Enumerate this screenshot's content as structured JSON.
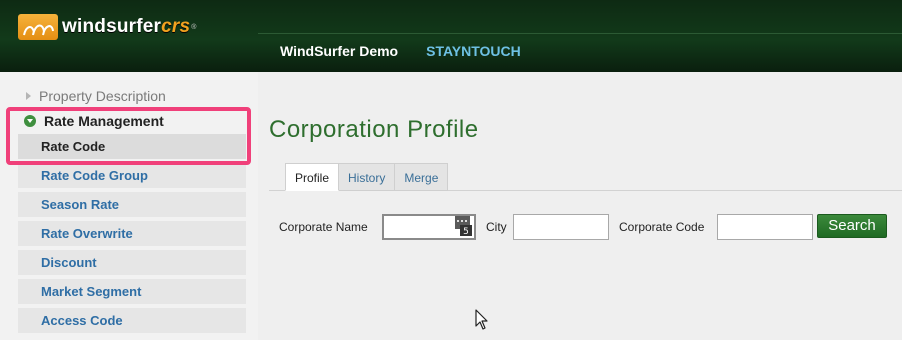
{
  "brand": {
    "logo_text_main": "windsurfer",
    "logo_text_accent": "crs",
    "trademark": "®"
  },
  "topnav": {
    "items": [
      "WindSurfer Demo",
      "STAYNTOUCH"
    ]
  },
  "sidebar": {
    "sections": [
      {
        "label": "Property Description",
        "expanded": false
      },
      {
        "label": "Rate Management",
        "expanded": true
      }
    ],
    "items": [
      {
        "label": "Rate Code",
        "active": true
      },
      {
        "label": "Rate Code Group"
      },
      {
        "label": "Season Rate"
      },
      {
        "label": "Rate Overwrite"
      },
      {
        "label": "Discount"
      },
      {
        "label": "Market Segment"
      },
      {
        "label": "Access Code"
      }
    ]
  },
  "main": {
    "title": "Corporation Profile",
    "tabs": [
      {
        "label": "Profile",
        "active": true
      },
      {
        "label": "History"
      },
      {
        "label": "Merge"
      }
    ],
    "form": {
      "corporate_name_label": "Corporate Name",
      "corporate_name_value": "",
      "city_label": "City",
      "city_value": "",
      "corporate_code_label": "Corporate Code",
      "corporate_code_value": "",
      "search_label": "Search"
    }
  },
  "colors": {
    "header_bg": "#123a1a",
    "title_green": "#2e6e2e",
    "link_blue": "#2f6ea5",
    "highlight": "#f0407a",
    "button_green": "#2d7a2f"
  }
}
